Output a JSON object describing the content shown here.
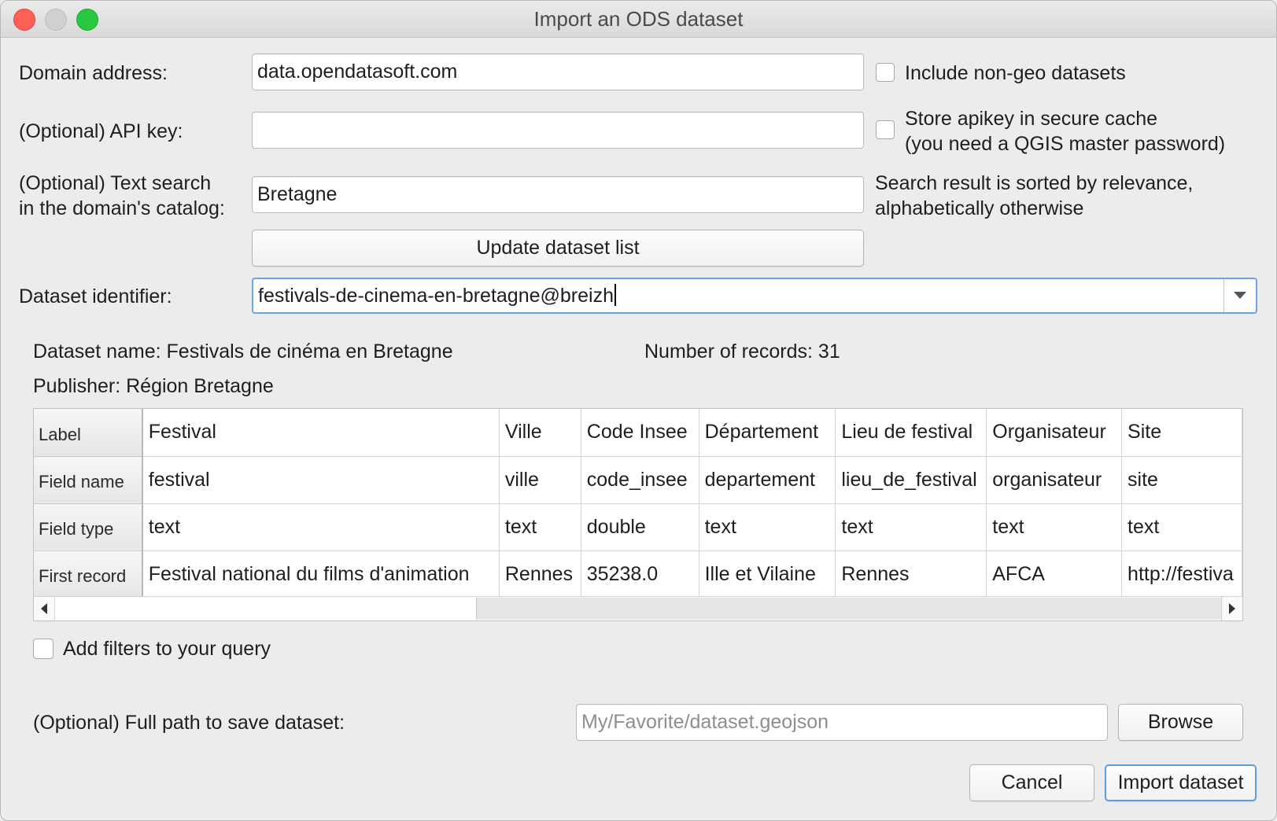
{
  "window": {
    "title": "Import an ODS dataset"
  },
  "form": {
    "domain_label": "Domain address:",
    "domain_value": "data.opendatasoft.com",
    "include_nongeo_label": "Include non-geo datasets",
    "include_nongeo_checked": false,
    "apikey_label": "(Optional) API key:",
    "apikey_value": "",
    "store_apikey_line1": "Store apikey in secure cache",
    "store_apikey_line2": "(you need a QGIS master password)",
    "store_apikey_checked": false,
    "search_label_line1": "(Optional) Text search",
    "search_label_line2": "in the domain's catalog:",
    "search_value": "Bretagne",
    "search_note_line1": "Search result is sorted by relevance,",
    "search_note_line2": "alphabetically otherwise",
    "update_button": "Update dataset list",
    "dataset_id_label": "Dataset identifier:",
    "dataset_id_value": "festivals-de-cinema-en-bretagne@breizh"
  },
  "info": {
    "dataset_name": "Dataset name: Festivals de cinéma en Bretagne",
    "num_records": "Number of records: 31",
    "publisher": "Publisher: Région Bretagne"
  },
  "table": {
    "row_headers": [
      "Label",
      "Field name",
      "Field type",
      "First record"
    ],
    "columns": [
      {
        "label": "Festival",
        "field_name": "festival",
        "field_type": "text",
        "first_record": "Festival national du films d'animation"
      },
      {
        "label": "Ville",
        "field_name": "ville",
        "field_type": "text",
        "first_record": "Rennes"
      },
      {
        "label": "Code Insee",
        "field_name": "code_insee",
        "field_type": "double",
        "first_record": "35238.0"
      },
      {
        "label": "Département",
        "field_name": "departement",
        "field_type": "text",
        "first_record": "Ille et Vilaine"
      },
      {
        "label": "Lieu de festival",
        "field_name": "lieu_de_festival",
        "field_type": "text",
        "first_record": "Rennes"
      },
      {
        "label": "Organisateur",
        "field_name": "organisateur",
        "field_type": "text",
        "first_record": "AFCA"
      },
      {
        "label": "Site",
        "field_name": "site",
        "field_type": "text",
        "first_record": "http://festiva"
      }
    ]
  },
  "filters": {
    "add_filters_label": "Add filters to your query",
    "add_filters_checked": false
  },
  "save": {
    "label": "(Optional) Full path to save dataset:",
    "placeholder": "My/Favorite/dataset.geojson",
    "browse_button": "Browse"
  },
  "actions": {
    "cancel_button": "Cancel",
    "import_button": "Import dataset"
  }
}
